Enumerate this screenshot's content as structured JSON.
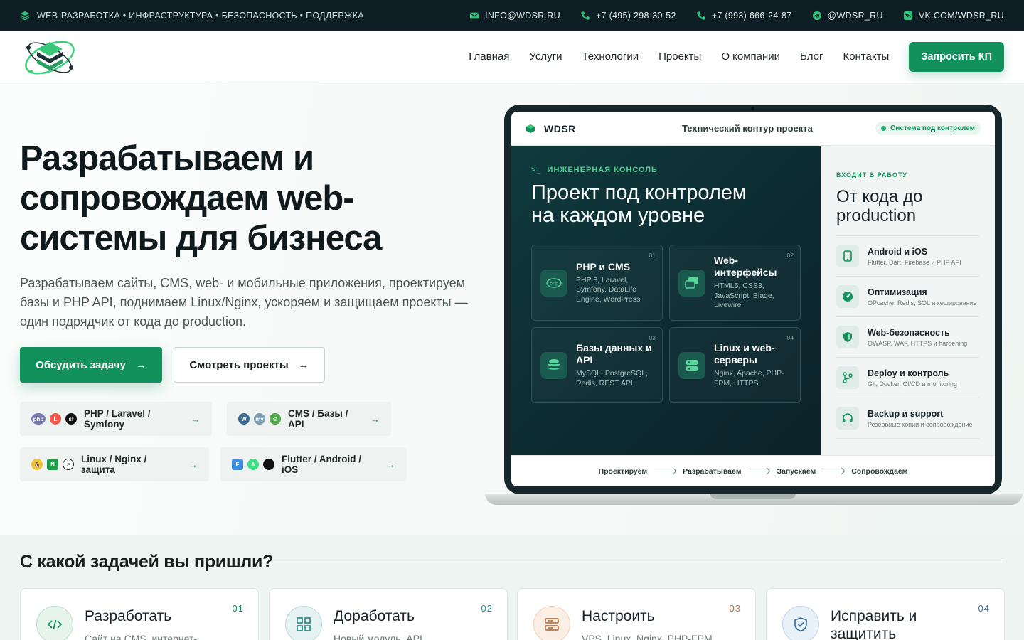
{
  "topbar": {
    "tagline": "WEB-РАЗРАБОТКА • ИНФРАСТРУКТУРА • БЕЗОПАСНОСТЬ • ПОДДЕРЖКА",
    "email": "INFO@WDSR.RU",
    "phone1": "+7 (495) 298-30-52",
    "phone2": "+7 (993) 666-24-87",
    "telegram": "@WDSR_RU",
    "vk": "VK.COM/WDSR_RU"
  },
  "nav": {
    "items": [
      "Главная",
      "Услуги",
      "Технологии",
      "Проекты",
      "О компании",
      "Блог",
      "Контакты"
    ],
    "cta": "Запросить КП"
  },
  "hero": {
    "title": "Разрабатываем и сопровождаем web-системы для бизнеса",
    "subtitle": "Разрабатываем сайты, CMS, web- и мобильные приложения, проектируем базы и PHP API, поднимаем Linux/Nginx, ускоряем и защищаем проекты — один подрядчик от кода до production.",
    "primary_btn": "Обсудить задачу",
    "secondary_btn": "Смотреть проекты",
    "chips": [
      "PHP / Laravel / Symfony",
      "CMS / Базы / API",
      "Linux / Nginx / защита",
      "Flutter / Android / iOS"
    ]
  },
  "screen": {
    "brand": "WDSR",
    "title": "Технический контур проекта",
    "status": "Система под контролем",
    "console_label": "ИНЖЕНЕРНАЯ КОНСОЛЬ",
    "console_title": "Проект под контролем на каждом уровне",
    "cards": [
      {
        "num": "01",
        "title": "PHP и CMS",
        "desc": "PHP 8, Laravel, Symfony, DataLife Engine, WordPress"
      },
      {
        "num": "02",
        "title": "Web-интерфейсы",
        "desc": "HTML5, CSS3, JavaScript, Blade, Livewire"
      },
      {
        "num": "03",
        "title": "Базы данных и API",
        "desc": "MySQL, PostgreSQL, Redis, REST API"
      },
      {
        "num": "04",
        "title": "Linux и web-серверы",
        "desc": "Nginx, Apache, PHP-FPM, HTTPS"
      }
    ],
    "side_label": "ВХОДИТ В РАБОТУ",
    "side_title": "От кода до production",
    "side_items": [
      {
        "title": "Android и iOS",
        "desc": "Flutter, Dart, Firebase и PHP API"
      },
      {
        "title": "Оптимизация",
        "desc": "OPcache, Redis, SQL и кеширование"
      },
      {
        "title": "Web-безопасность",
        "desc": "OWASP, WAF, HTTPS и hardening"
      },
      {
        "title": "Deploy и контроль",
        "desc": "Git, Docker, CI/CD и monitoring"
      },
      {
        "title": "Backup и support",
        "desc": "Резервные копии и сопровождение"
      }
    ],
    "flow": [
      "Проектируем",
      "Разрабатываем",
      "Запускаем",
      "Сопровождаем"
    ]
  },
  "tasks": {
    "title": "С какой задачей вы пришли?",
    "items": [
      {
        "num": "01",
        "title": "Разработать",
        "desc": "Сайт на CMS, интернет-",
        "color": "#13915c"
      },
      {
        "num": "02",
        "title": "Доработать",
        "desc": "Новый модуль, API",
        "color": "#2a8f86"
      },
      {
        "num": "03",
        "title": "Настроить",
        "desc": "VPS, Linux, Nginx, PHP-FPM",
        "color": "#c0703d"
      },
      {
        "num": "04",
        "title": "Исправить и защитить",
        "desc": "",
        "color": "#3c6fa3"
      }
    ]
  },
  "colors": {
    "accent": "#13915c",
    "dark": "#0f1e24"
  }
}
